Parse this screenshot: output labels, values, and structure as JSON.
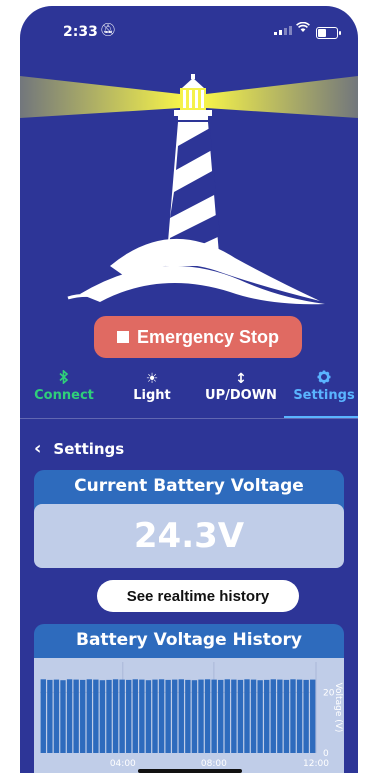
{
  "status_bar": {
    "time": "2:33",
    "icons": [
      "bell-slash-icon",
      "signal-icon",
      "wifi-icon",
      "battery-icon"
    ]
  },
  "emergency_stop": {
    "label": "Emergency Stop",
    "color": "#e06a62"
  },
  "tabs": [
    {
      "id": "connect",
      "icon": "bluetooth-icon",
      "label": "Connect"
    },
    {
      "id": "light",
      "icon": "sun-icon",
      "label": "Light"
    },
    {
      "id": "updown",
      "icon": "up-down-arrow-icon",
      "label": "UP/DOWN"
    },
    {
      "id": "settings",
      "icon": "gear-icon",
      "label": "Settings",
      "active": true
    }
  ],
  "settings_header": {
    "label": "Settings"
  },
  "battery_card": {
    "title": "Current Battery Voltage",
    "value": "24.3V"
  },
  "history_button": {
    "label": "See realtime history"
  },
  "history_card": {
    "title": "Battery Voltage History"
  },
  "colors": {
    "background": "#2d3597",
    "card": "#2e6bbd",
    "value_box": "#c0cde8",
    "bar": "#2e6bbd",
    "active_tab": "#5ab4ff",
    "connect_tab": "#2fcf7a"
  },
  "chart_data": {
    "type": "bar",
    "x_ticks": [
      "04:00",
      "08:00",
      "12:00"
    ],
    "y_ticks": [
      "0",
      "20"
    ],
    "ylabel": "Voltage (V)",
    "ylim": [
      0,
      30
    ],
    "values": [
      24.3,
      24.1,
      24.2,
      24.0,
      24.3,
      24.2,
      24.1,
      24.3,
      24.2,
      24.0,
      24.1,
      24.3,
      24.2,
      24.1,
      24.3,
      24.2,
      24.0,
      24.2,
      24.3,
      24.1,
      24.2,
      24.3,
      24.1,
      24.0,
      24.2,
      24.3,
      24.2,
      24.1,
      24.3,
      24.2,
      24.1,
      24.3,
      24.2,
      24.0,
      24.1,
      24.3,
      24.2,
      24.1,
      24.3,
      24.2,
      24.1,
      24.2
    ]
  }
}
